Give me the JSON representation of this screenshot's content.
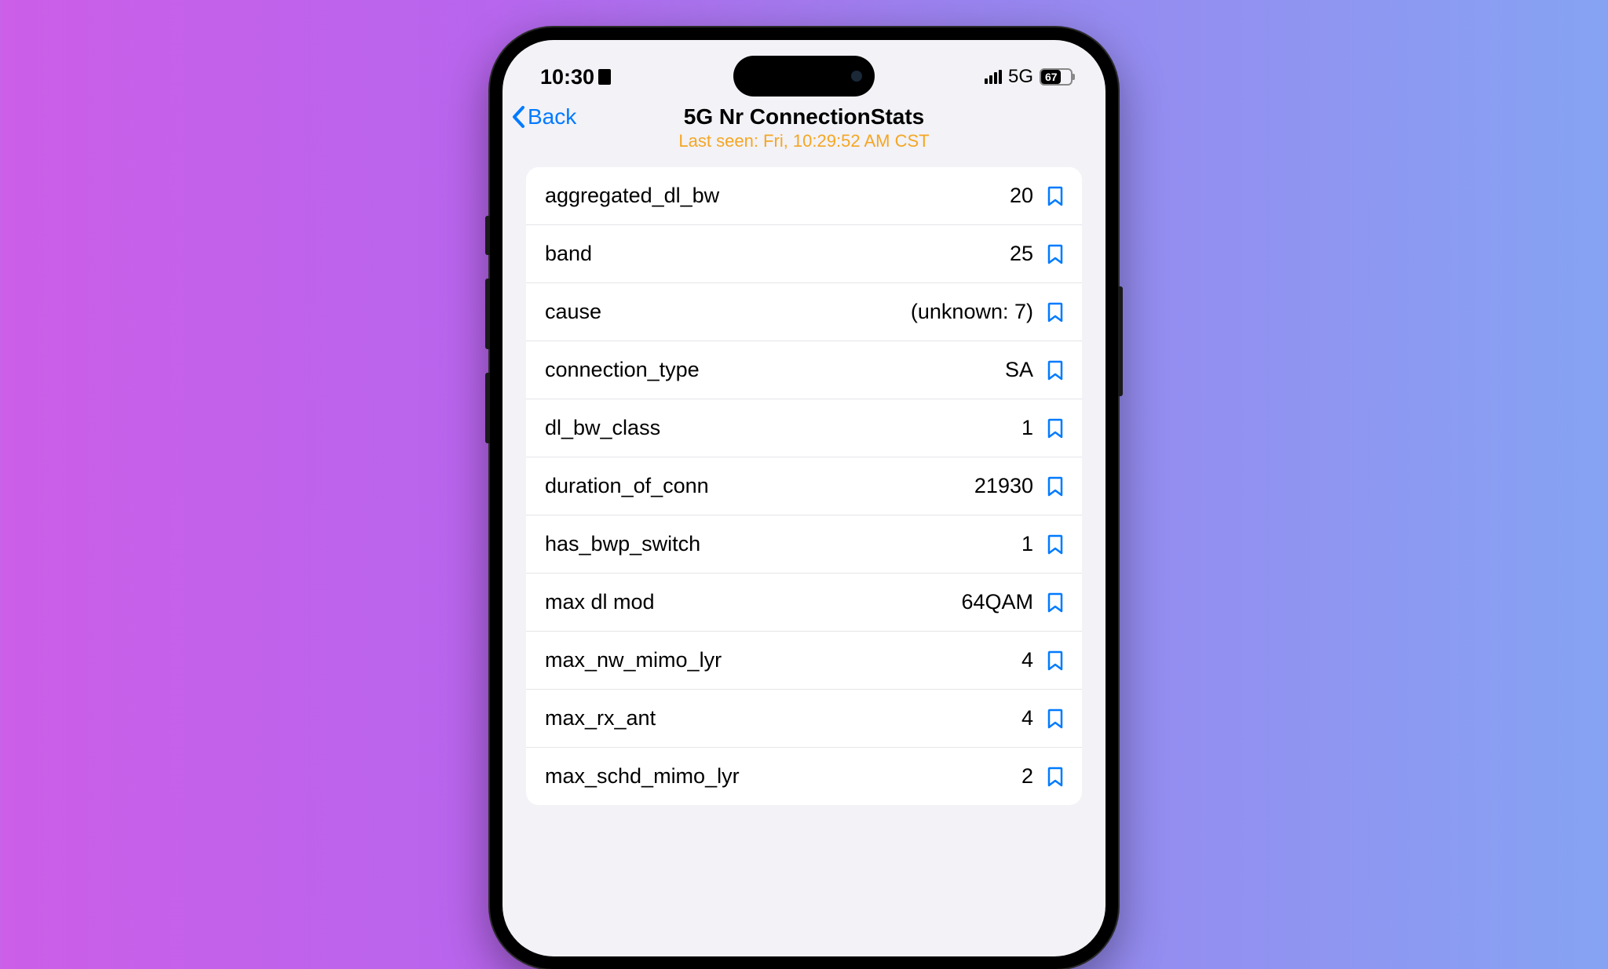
{
  "status_bar": {
    "time": "10:30",
    "network": "5G",
    "battery": "67"
  },
  "header": {
    "back_label": "Back",
    "title": "5G Nr ConnectionStats",
    "subtitle": "Last seen: Fri, 10:29:52 AM CST"
  },
  "stats": [
    {
      "label": "aggregated_dl_bw",
      "value": "20"
    },
    {
      "label": "band",
      "value": "25"
    },
    {
      "label": "cause",
      "value": "(unknown: 7)"
    },
    {
      "label": "connection_type",
      "value": "SA"
    },
    {
      "label": "dl_bw_class",
      "value": "1"
    },
    {
      "label": "duration_of_conn",
      "value": "21930"
    },
    {
      "label": "has_bwp_switch",
      "value": "1"
    },
    {
      "label": "max dl mod",
      "value": "64QAM"
    },
    {
      "label": "max_nw_mimo_lyr",
      "value": "4"
    },
    {
      "label": "max_rx_ant",
      "value": "4"
    },
    {
      "label": "max_schd_mimo_lyr",
      "value": "2"
    }
  ]
}
